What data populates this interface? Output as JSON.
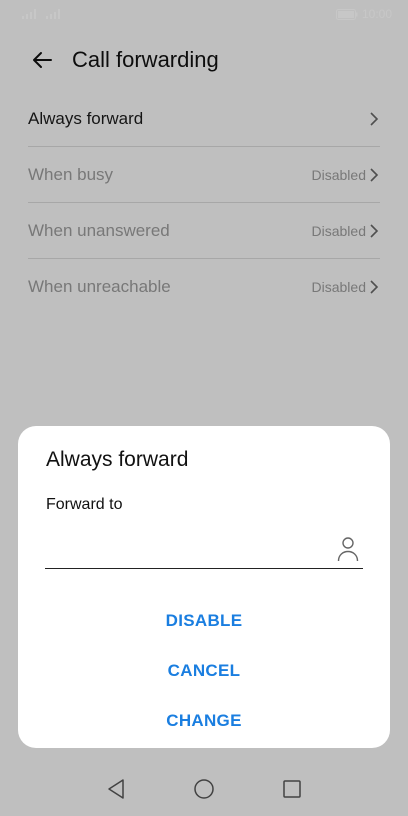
{
  "status_bar": {
    "time": "10:00",
    "icons": [
      "signal-1-icon",
      "signal-2-icon",
      "battery-icon"
    ]
  },
  "header": {
    "back_icon": "arrow-left-icon",
    "title": "Call forwarding"
  },
  "list": {
    "items": [
      {
        "label": "Always forward",
        "value": "",
        "enabled": true
      },
      {
        "label": "When busy",
        "value": "Disabled",
        "enabled": false
      },
      {
        "label": "When unanswered",
        "value": "Disabled",
        "enabled": false
      },
      {
        "label": "When unreachable",
        "value": "Disabled",
        "enabled": false
      }
    ]
  },
  "dialog": {
    "title": "Always forward",
    "field_label": "Forward to",
    "field_value": "",
    "contact_icon": "person-icon",
    "actions": {
      "disable": "DISABLE",
      "cancel": "CANCEL",
      "change": "CHANGE"
    },
    "accent_color": "#1a7ee0"
  },
  "nav_bar": {
    "icons": [
      "back-triangle-icon",
      "home-circle-icon",
      "recents-square-icon"
    ]
  }
}
